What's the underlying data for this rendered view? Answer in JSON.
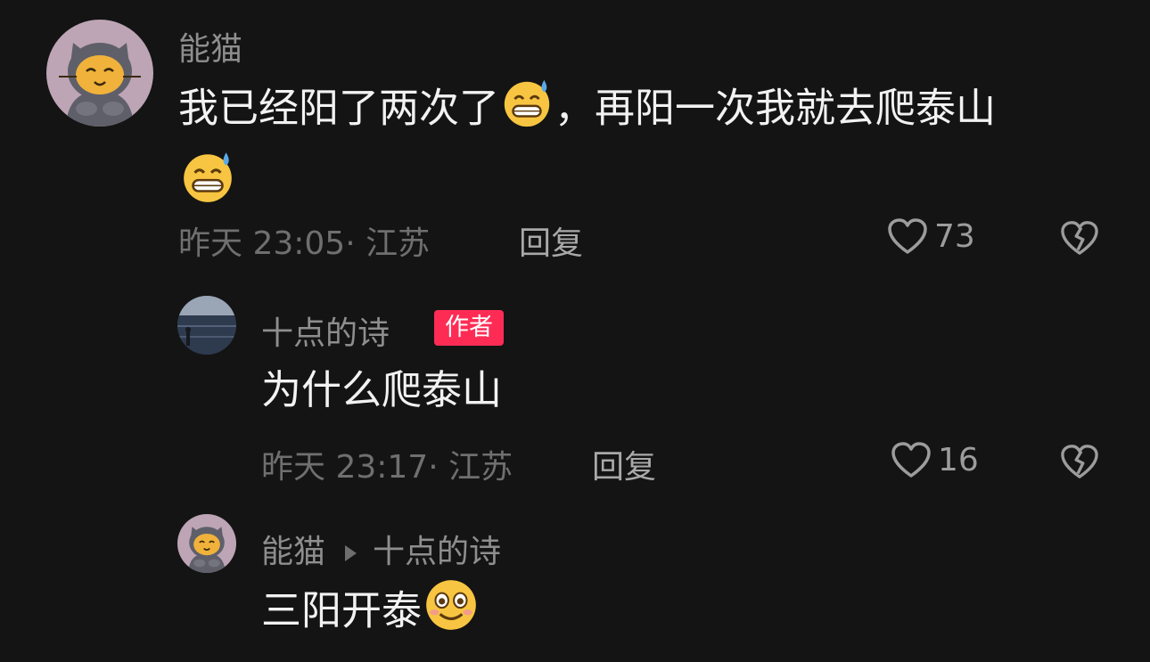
{
  "comments": [
    {
      "author": "能猫",
      "text_before": "我已经阳了两次了",
      "text_after": "，再阳一次我就去爬泰山",
      "emoji": "grinning-sweat-emoji",
      "time": "昨天 23:05· 江苏",
      "reply": "回复",
      "likes": "73"
    },
    {
      "author": "十点的诗",
      "badge": "作者",
      "text": "为什么爬泰山",
      "time": "昨天 23:17· 江苏",
      "reply": "回复",
      "likes": "16"
    },
    {
      "author": "能猫",
      "reply_to": "十点的诗",
      "text": "三阳开泰",
      "emoji": "smiling-face-emoji"
    }
  ],
  "colors": {
    "background": "#141414",
    "badge": "#fe2c55"
  }
}
